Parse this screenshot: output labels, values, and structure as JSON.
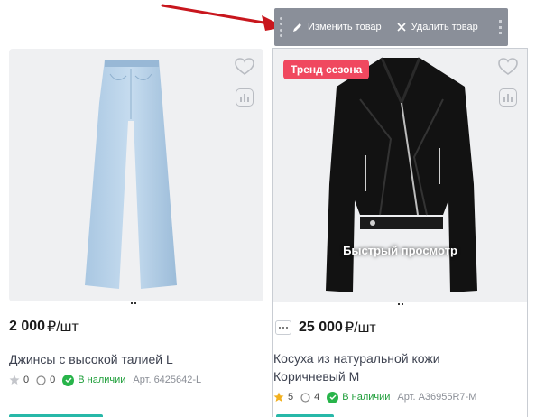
{
  "admin_bar": {
    "edit_label": "Изменить товар",
    "delete_label": "Удалить товар"
  },
  "products": [
    {
      "price": "2 000",
      "price_unit": "₽/шт",
      "title": "Джинсы с высокой талией L",
      "rating": "0",
      "reviews": "0",
      "stock": "В наличии",
      "article": "Арт. 6425642-L"
    },
    {
      "badge": "Тренд сезона",
      "quick_view": "Быстрый просмотр",
      "price": "25 000",
      "price_unit": "₽/шт",
      "title_line1": "Косуха из натуральной кожи",
      "title_line2": "Коричневый M",
      "rating": "5",
      "reviews": "4",
      "stock": "В наличии",
      "article": "Арт. A36955R7-M"
    }
  ],
  "colors": {
    "badge": "#f0485f",
    "stock": "#28b44a",
    "admin_bar": "#8a8f99",
    "arrow": "#c8161d"
  }
}
